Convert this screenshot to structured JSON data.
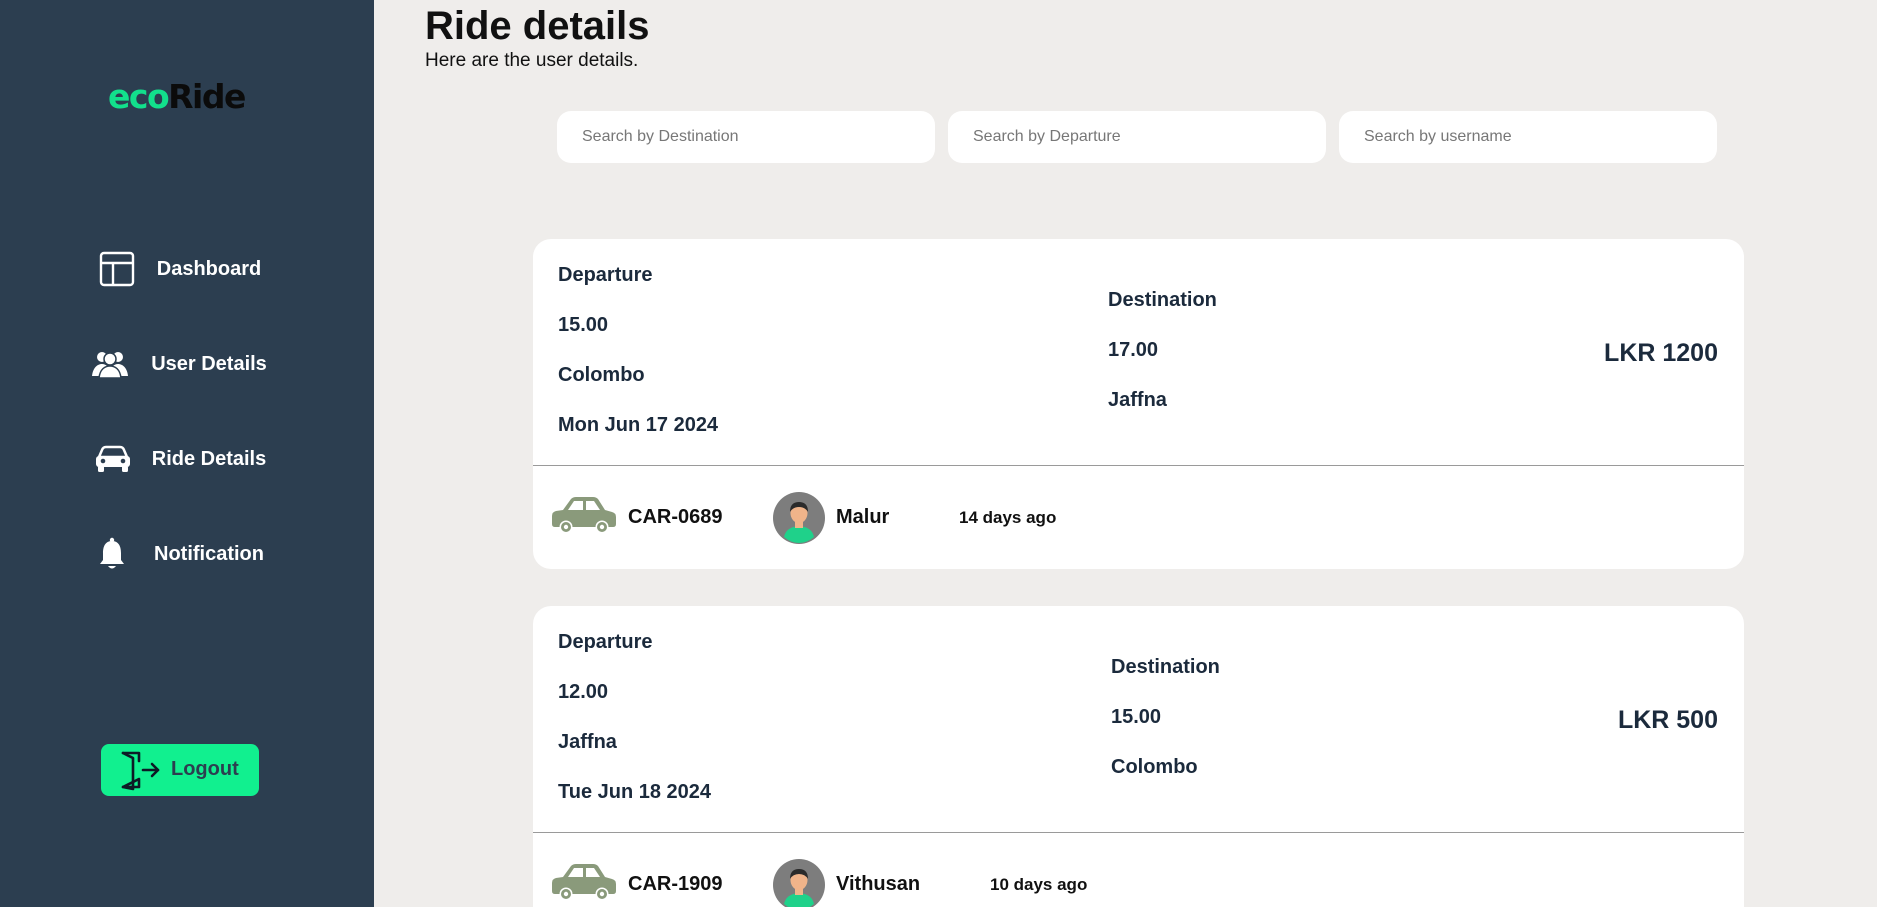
{
  "app": {
    "logo_part1": "eco",
    "logo_part2": "Ride"
  },
  "sidebar": {
    "items": [
      {
        "label": "Dashboard",
        "icon": "dashboard-icon"
      },
      {
        "label": "User Details",
        "icon": "users-icon"
      },
      {
        "label": "Ride Details",
        "icon": "car-icon"
      },
      {
        "label": "Notification",
        "icon": "bell-icon"
      }
    ],
    "logout_label": "Logout",
    "logout_icon": "logout-icon"
  },
  "header": {
    "title": "Ride details",
    "subtitle": "Here are the user details."
  },
  "search": {
    "destination_placeholder": "Search by Destination",
    "departure_placeholder": "Search by Departure",
    "username_placeholder": "Search by username"
  },
  "rides": [
    {
      "departure_label": "Departure",
      "departure_time": "15.00",
      "departure_city": "Colombo",
      "date": "Mon Jun 17 2024",
      "destination_label": "Destination",
      "destination_time": "17.00",
      "destination_city": "Jaffna",
      "price": "LKR 1200",
      "car": "CAR-0689",
      "driver": "Malur",
      "posted": "14 days ago"
    },
    {
      "departure_label": "Departure",
      "departure_time": "12.00",
      "departure_city": "Jaffna",
      "date": "Tue Jun 18 2024",
      "destination_label": "Destination",
      "destination_time": "15.00",
      "destination_city": "Colombo",
      "price": "LKR 500",
      "car": "CAR-1909",
      "driver": "Vithusan",
      "posted": "10 days ago"
    }
  ],
  "colors": {
    "sidebar_bg": "#2c3e50",
    "accent": "#11f08f",
    "page_bg": "#efedeb",
    "car_icon": "#8a9a7b"
  }
}
